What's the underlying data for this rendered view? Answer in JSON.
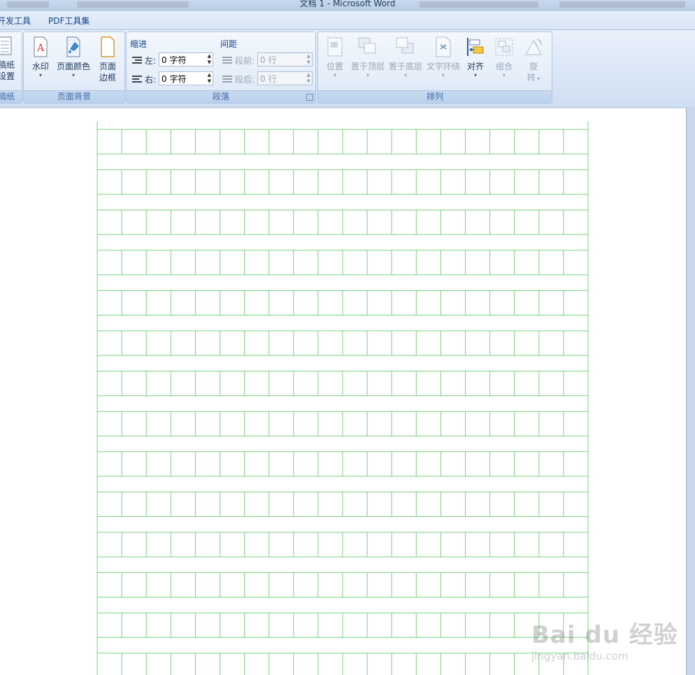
{
  "window": {
    "title": "文档 1 - Microsoft Word"
  },
  "menu": {
    "tabs": [
      "开发工具",
      "PDF工具集"
    ]
  },
  "ribbon": {
    "gaozhi": {
      "label_line1": "稿纸",
      "label_line2": "设置",
      "group_label": "稿纸"
    },
    "page_background": {
      "group_label": "页面背景",
      "watermark_btn": "水印",
      "page_color_btn": "页面颜色",
      "page_border_line1": "页面",
      "page_border_line2": "边框"
    },
    "paragraph": {
      "group_label": "段落",
      "indent_heading": "缩进",
      "spacing_heading": "间距",
      "indent_left_label": "左:",
      "indent_left_value": "0 字符",
      "indent_right_label": "右:",
      "indent_right_value": "0 字符",
      "space_before_label": "段前:",
      "space_before_value": "0 行",
      "space_after_label": "段后:",
      "space_after_value": "0 行"
    },
    "arrange": {
      "group_label": "排列",
      "position_btn": "位置",
      "bring_front_btn": "置于顶层",
      "send_back_btn": "置于底层",
      "text_wrap_btn": "文字环绕",
      "align_btn": "对齐",
      "group_btn": "组合",
      "rotate_line1": "旋",
      "rotate_line2": "转"
    }
  },
  "watermark_overlay": {
    "brand": "Bai du 经验",
    "url": "jingyan.baidu.com"
  },
  "document": {
    "grid_color": "#7ccf7c",
    "columns": 20,
    "rows_visible": 14
  }
}
